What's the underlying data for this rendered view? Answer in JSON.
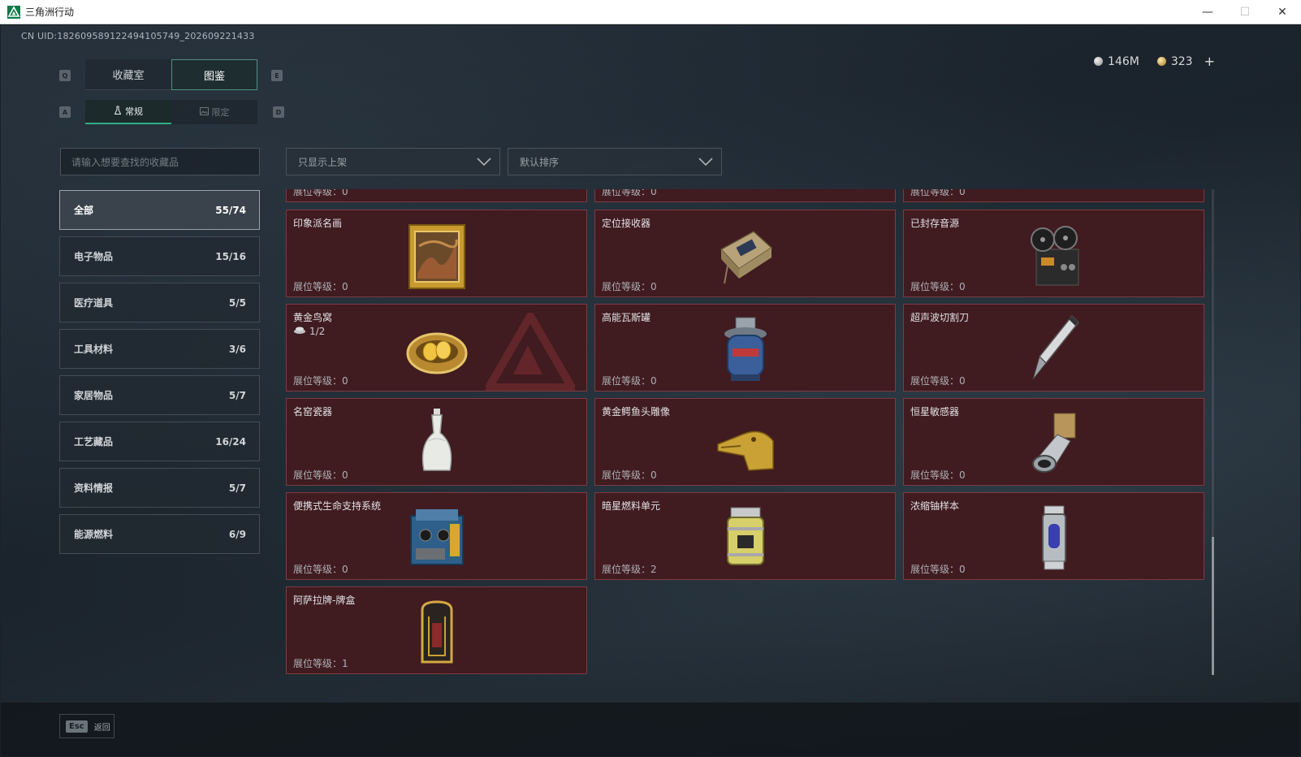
{
  "window": {
    "title": "三角洲行动",
    "minimize": "—",
    "maximize": "☐",
    "close": "✕"
  },
  "uid": "CN UID:1826095891224941057​49_202609221433",
  "currency": {
    "money": "146M",
    "coins": "323",
    "plus": "+"
  },
  "keyhints": {
    "q": "Q",
    "e": "E",
    "a": "A",
    "d": "D"
  },
  "tabs": [
    {
      "label": "收藏室"
    },
    {
      "label": "图鉴"
    }
  ],
  "subtabs": [
    {
      "label": "常规"
    },
    {
      "label": "限定"
    }
  ],
  "search": {
    "placeholder": "请输入想要查找的收藏品"
  },
  "filters": {
    "shelf": "只显示上架",
    "sort": "默认排序"
  },
  "categories": [
    {
      "label": "全部",
      "count": "55/74"
    },
    {
      "label": "电子物品",
      "count": "15/16"
    },
    {
      "label": "医疗道具",
      "count": "5/5"
    },
    {
      "label": "工具材料",
      "count": "3/6"
    },
    {
      "label": "家居物品",
      "count": "5/7"
    },
    {
      "label": "工艺藏品",
      "count": "16/24"
    },
    {
      "label": "资料情报",
      "count": "5/7"
    },
    {
      "label": "能源燃料",
      "count": "6/9"
    }
  ],
  "level_prefix": "展位等级：",
  "partial_row": [
    {
      "level": "展位等级：0"
    },
    {
      "level": "展位等级：0"
    },
    {
      "level": "展位等级：0"
    }
  ],
  "items": [
    {
      "name": "印象派名画",
      "level": "展位等级：0",
      "icon": "painting-icon"
    },
    {
      "name": "定位接收器",
      "level": "展位等级：0",
      "icon": "receiver-icon"
    },
    {
      "name": "已封存音源",
      "level": "展位等级：0",
      "icon": "reel-recorder-icon"
    },
    {
      "name": "黄金鸟窝",
      "level": "展位等级：0",
      "extra": "1/2",
      "icon": "golden-nest-icon"
    },
    {
      "name": "高能瓦斯罐",
      "level": "展位等级：0",
      "icon": "gas-canister-icon"
    },
    {
      "name": "超声波切割刀",
      "level": "展位等级：0",
      "icon": "ultrasonic-knife-icon"
    },
    {
      "name": "名窑瓷器",
      "level": "展位等级：0",
      "icon": "porcelain-vase-icon"
    },
    {
      "name": "黄金鳄鱼头雕像",
      "level": "展位等级：0",
      "icon": "golden-croc-icon"
    },
    {
      "name": "恒星敏感器",
      "level": "展位等级：0",
      "icon": "star-sensor-icon"
    },
    {
      "name": "便携式生命支持系统",
      "level": "展位等级：0",
      "icon": "life-support-icon"
    },
    {
      "name": "暗星燃料单元",
      "level": "展位等级：2",
      "icon": "fuel-cell-icon"
    },
    {
      "name": "浓缩铀样本",
      "level": "展位等级：0",
      "icon": "uranium-sample-icon"
    },
    {
      "name": "阿萨拉牌-牌盒",
      "level": "展位等级：1",
      "icon": "card-box-icon"
    }
  ],
  "bottom": {
    "esc_key": "Esc",
    "esc_label": "返回"
  },
  "colors": {
    "card_bg": "#401b20",
    "card_border": "#7a3c43",
    "accent": "#2fae86"
  }
}
